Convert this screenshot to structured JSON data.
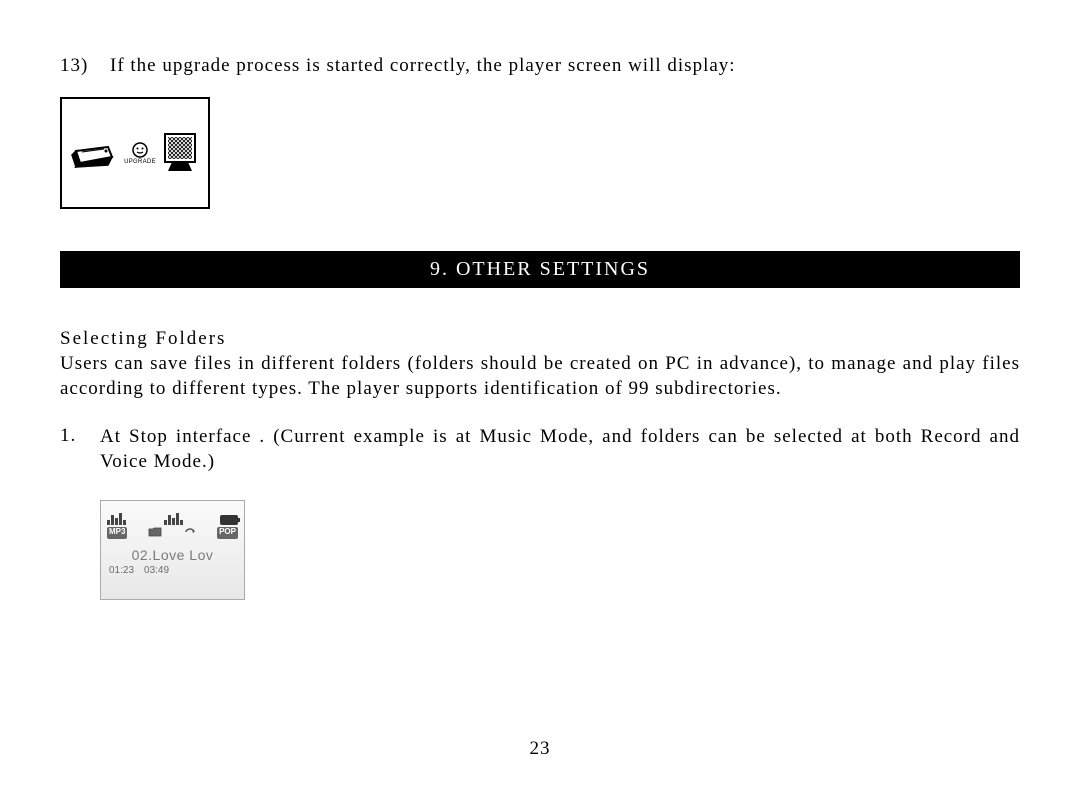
{
  "step": {
    "number": "13)",
    "text": "If the upgrade process is started correctly, the player screen will display:"
  },
  "section": {
    "header": "9.  OTHER SETTINGS"
  },
  "subsection": {
    "title": "Selecting Folders",
    "body": "Users can save files in different folders (folders should be created on PC in advance), to manage and play files according to different types. The player supports identification of 99 subdirectories."
  },
  "list": {
    "item1": {
      "number": "1.",
      "text": "At Stop interface . (Current example is at Music Mode, and folders can be selected at both Record and Voice Mode.)"
    }
  },
  "pageNumber": "23",
  "lcd1": {
    "label": "UPGRADE"
  },
  "lcd2": {
    "badge1": "MP3",
    "badge2": "POP",
    "songTitle": "02.Love Lov",
    "time1": "01:23",
    "time2": "03:49"
  }
}
